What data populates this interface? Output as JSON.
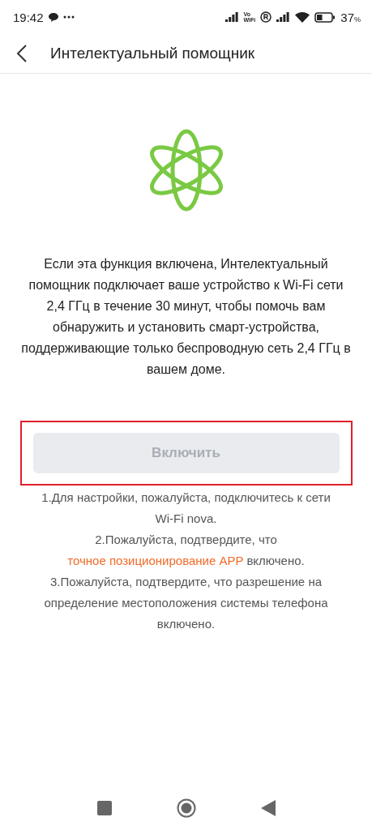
{
  "status_bar": {
    "time": "19:42",
    "vowifi": [
      "Vo",
      "WiFi"
    ],
    "battery": "37",
    "battery_unit": "%"
  },
  "header": {
    "title": "Интелектуальный помощник"
  },
  "description": "Если эта функция включена, Интелектуальный помощник подключает ваше устройство к Wi-Fi сети 2,4 ГГц в течение 30 минут, чтобы помочь вам обнаружить и установить смарт-устройства, поддерживающие только беспроводную сеть 2,4 ГГц в вашем доме.",
  "enable_button": {
    "label": "Включить",
    "disabled": true,
    "highlighted": true
  },
  "instructions": [
    {
      "parts": [
        {
          "kind": "text",
          "text": "1.Для настройки, пожалуйста, подключитесь к сети Wi-Fi nova."
        }
      ]
    },
    {
      "parts": [
        {
          "kind": "text",
          "text": "2.Пожалуйста, подтвердите, что "
        },
        {
          "kind": "link",
          "text": "точное позиционирование APP"
        },
        {
          "kind": "text",
          "text": " включено."
        }
      ]
    },
    {
      "parts": [
        {
          "kind": "text",
          "text": "3.Пожалуйста, подтвердите, что разрешение на определение местоположения системы телефона включено."
        }
      ]
    }
  ]
}
